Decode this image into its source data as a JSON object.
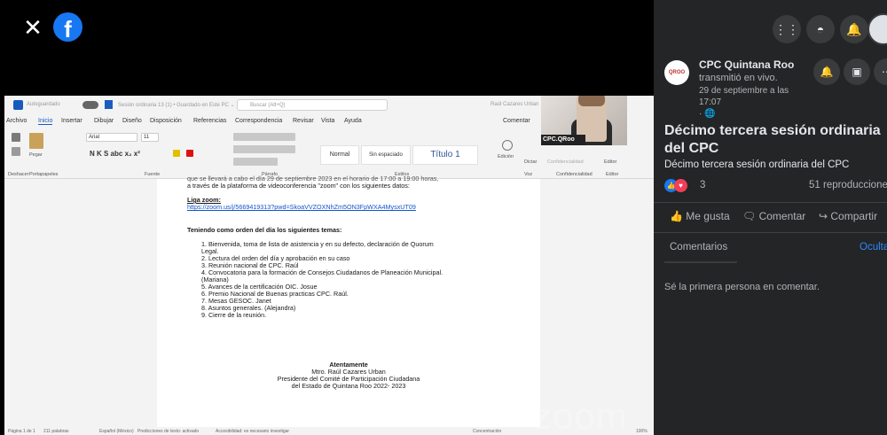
{
  "viewer": {
    "close_icon": "close-icon",
    "logo": "f"
  },
  "word": {
    "autosave_label": "Autoguardado",
    "doc_title": "Sesión ordinaria 13 (1) • Guardado en Este PC ⌄",
    "search_placeholder": "Buscar (Alt+Q)",
    "user_name": "Raúl Cazares Urban",
    "menu": [
      "Archivo",
      "Inicio",
      "Insertar",
      "Dibujar",
      "Diseño",
      "Disposición",
      "Referencias",
      "Correspondencia",
      "Revisar",
      "Vista",
      "Ayuda"
    ],
    "comments_btn": "Comentar",
    "font_name": "Arial",
    "font_size": "11",
    "styles": [
      "Normal",
      "Sin espaciado",
      "Título 1"
    ],
    "group_labels": [
      "Deshacer",
      "Portapapeles",
      "Fuente",
      "Párrafo",
      "Estilos",
      "Voz",
      "Confidencialidad",
      "Editor"
    ],
    "ribbon_buttons": [
      "Pegar",
      "Edición",
      "Dictar",
      "Confidencialidad",
      "Editor"
    ],
    "status": [
      "Página 1 de 1",
      "211 palabras",
      "Español (México)",
      "Predicciones de texto: activado",
      "Accesibilidad: es necesario investigar",
      "Concentración",
      "100%"
    ]
  },
  "doc": {
    "line_top": "que se llevará a cabo el día 29 de septiembre 2023 en el horario de 17:00 a 19:00 horas,",
    "line2": "a través de la plataforma de videoconferencia \"zoom\" con los siguientes datos:",
    "liga_label": "Liga zoom:",
    "liga_url": "https://zoom.us/j/5669419313?pwd=SkoaVVZOXNhZm5ON3FpWXA4MysxUT09",
    "agenda_heading": "Teniendo como orden del día los siguientes temas:",
    "agenda": [
      "1.  Bienvenida, toma de lista de asistencia y en su defecto, declaración de Quorum",
      "     Legal.",
      "2.  Lectura del orden del día y aprobación en su caso",
      "3.  Reunión nacional de CPC. Raúl",
      "4.  Convocatoria para la formación de Consejos Ciudadanos de Planeación Municipal.",
      "     (Mariana)",
      "5.  Avances de la certificación OIC. Josue",
      "6.  Premio Nacional de Buenas practicas CPC. Raúl.",
      "7.  Mesas GESOC. Janet",
      "8.  Asuntos generales. (Alejandra)",
      "9.  Cierre de la reunión."
    ],
    "closing": "Atentamente",
    "sign1": "Mtro. Raúl Cazares Urban",
    "sign2": "Presidente del Comité de Participación Ciudadana",
    "sign3": "del Estado de Quintana Roo 2022- 2023"
  },
  "pip": {
    "name": "CPC.QRoo"
  },
  "zoom_watermark": "zoom",
  "panel": {
    "top_icons": [
      "grid-icon",
      "messenger-icon",
      "bell-icon"
    ],
    "page_avatar_text": "QROO",
    "page_name": "CPC Quintana Roo",
    "action": "transmitió en vivo.",
    "date_line1": "29 de septiembre a las",
    "date_line2": "17:07",
    "post_title": "Décimo tercera sesión ordinaria del CPC",
    "post_subtitle": "Décimo tercera sesión ordinaria del CPC",
    "reaction_count": "3",
    "views": "51 reproducciones",
    "like_label": "Me gusta",
    "comment_label": "Comentar",
    "share_label": "Compartir",
    "comments_tab": "Comentarios",
    "hide_label": "Ocultar",
    "first_comment": "Sé la primera persona en comentar."
  },
  "colors": {
    "fb_blue": "#1877f2",
    "panel_bg": "#242526",
    "word_blue": "#185abd"
  }
}
